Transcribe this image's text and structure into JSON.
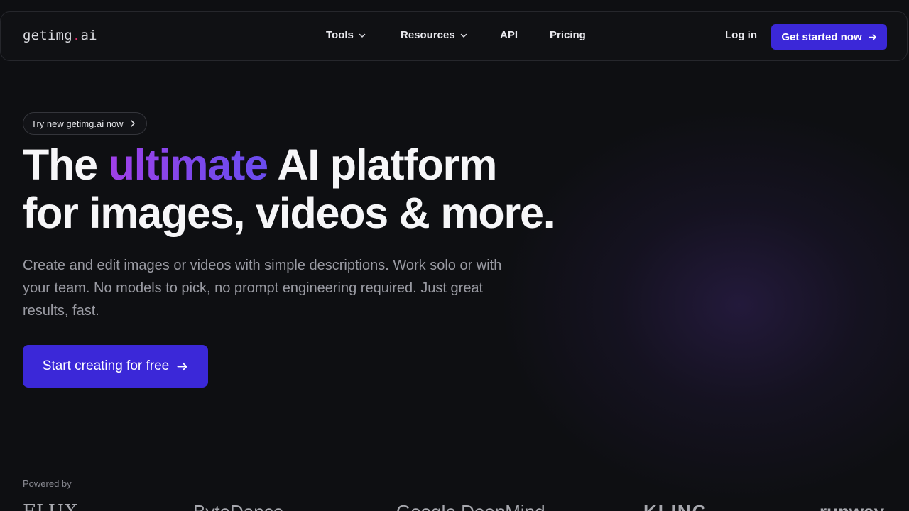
{
  "brand": {
    "name_main": "getimg",
    "name_dot": ".",
    "name_tld": "ai"
  },
  "nav": {
    "items": [
      {
        "label": "Tools",
        "has_dropdown": true
      },
      {
        "label": "Resources",
        "has_dropdown": true
      },
      {
        "label": "API",
        "has_dropdown": false
      },
      {
        "label": "Pricing",
        "has_dropdown": false
      }
    ],
    "login_label": "Log in",
    "cta_label": "Get started now"
  },
  "announcement": {
    "label": "Try new getimg.ai now"
  },
  "hero": {
    "headline_start": "The ",
    "headline_accent": "ultimate",
    "headline_rest_line1": " AI platform",
    "headline_line2": "for images, videos & more.",
    "subtitle": "Create and edit images or videos with simple descriptions. Work solo or with your team. No models to pick, no prompt engineering required. Just great results, fast.",
    "cta_label": "Start creating for free"
  },
  "powered_by": {
    "label": "Powered by",
    "partners": [
      "FLUX",
      "ByteDance",
      "Google DeepMind",
      "KLING",
      "runway"
    ]
  },
  "colors": {
    "background": "#0e0f12",
    "primary": "#3b28d8",
    "accent_start": "#a040e8",
    "accent_end": "#6a4cee",
    "logo_dot": "#e0306b"
  },
  "icons": {
    "dropdown": "chevron-down-icon",
    "cta_arrow": "arrow-right-icon",
    "pill_arrow": "chevron-right-icon"
  }
}
